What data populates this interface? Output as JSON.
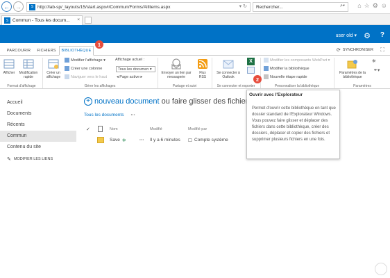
{
  "browser": {
    "url": "http://lab-sp/_layouts/15/start.aspx#/Commun/Forms/AllItems.aspx",
    "url_refresh": "▾ ↻",
    "search_placeholder": "Rechercher...",
    "tab_title": "Commun - Tous les docum...",
    "tab_close": "×",
    "site_icon_letter": "S"
  },
  "suitebar": {
    "user": "user old ▾",
    "gear": "⚙",
    "help": "?",
    "brand_color": "#0072c6"
  },
  "ribbon": {
    "tabs": [
      "PARCOURIR",
      "FICHIERS",
      "BIBLIOTHÈQUE"
    ],
    "active_tab": "BIBLIOTHÈQUE",
    "sync": "SYNCHRONISER",
    "groups": [
      "Format d'affichage",
      "Gérer les affichages",
      "Partage et suivi",
      "Se connecter et exporter",
      "Personnaliser la bibliothèque",
      "Paramètres"
    ],
    "afficher": "Afficher",
    "modification_rapide": "Modification rapide",
    "creer_affichage": "Créer un affichage",
    "modifier_affichage": "Modifier l'affichage ▾",
    "creer_colonne": "Créer une colonne",
    "naviguer_haut": "Naviguer vers le haut",
    "affichage_actuel_label": "Affichage actuel :",
    "affichage_actuel_value": "Tous les documen ▾",
    "page_active": "◂  Page active  ▸",
    "envoyer_lien": "Envoyer un lien par messagerie",
    "flux_rss": "Flux RSS",
    "se_connecter_outlook": "Se connecter à Outlook",
    "modifier_webpart": "Modifier les composants WebPart ▾",
    "modifier_bibliotheque": "Modifier la bibliothèque",
    "nouvelle_etape": "Nouvelle étape rapide",
    "parametres_bibliotheque": "Paramètres de la bibliothèque"
  },
  "leftnav": {
    "items": [
      "Accueil",
      "Documents",
      "Récents",
      "Commun",
      "Contenu du site"
    ],
    "selected": "Commun",
    "edit_links": "MODIFIER LES LIENS"
  },
  "main": {
    "new_doc_link": "nouveau document",
    "new_doc_rest": " ou faire glisser des fichiers ici",
    "view_all": "Tous les documents",
    "view_more": "···",
    "columns": [
      "Nom",
      "Modifié",
      "Modifié par"
    ],
    "rows": [
      {
        "name": "Save",
        "new_mark": "✲",
        "menu": "···",
        "modified": "Il y a 6 minutes",
        "modified_by": "Compte système"
      }
    ]
  },
  "tooltip": {
    "title": "Ouvrir avec l'Explorateur",
    "body": "Permet d'ouvrir cette bibliothèque en tant que dossier standard de l'Explorateur Windows. Vous pouvez faire glisser et déplacer des fichiers dans cette bibliothèque, créer des dossiers, déplacer et copier des fichiers et supprimer plusieurs fichiers en une fois."
  },
  "markers": [
    "1",
    "2"
  ],
  "colors": {
    "marker": "#e74c3c",
    "link": "#0072c6",
    "folder": "#f3c94b"
  }
}
